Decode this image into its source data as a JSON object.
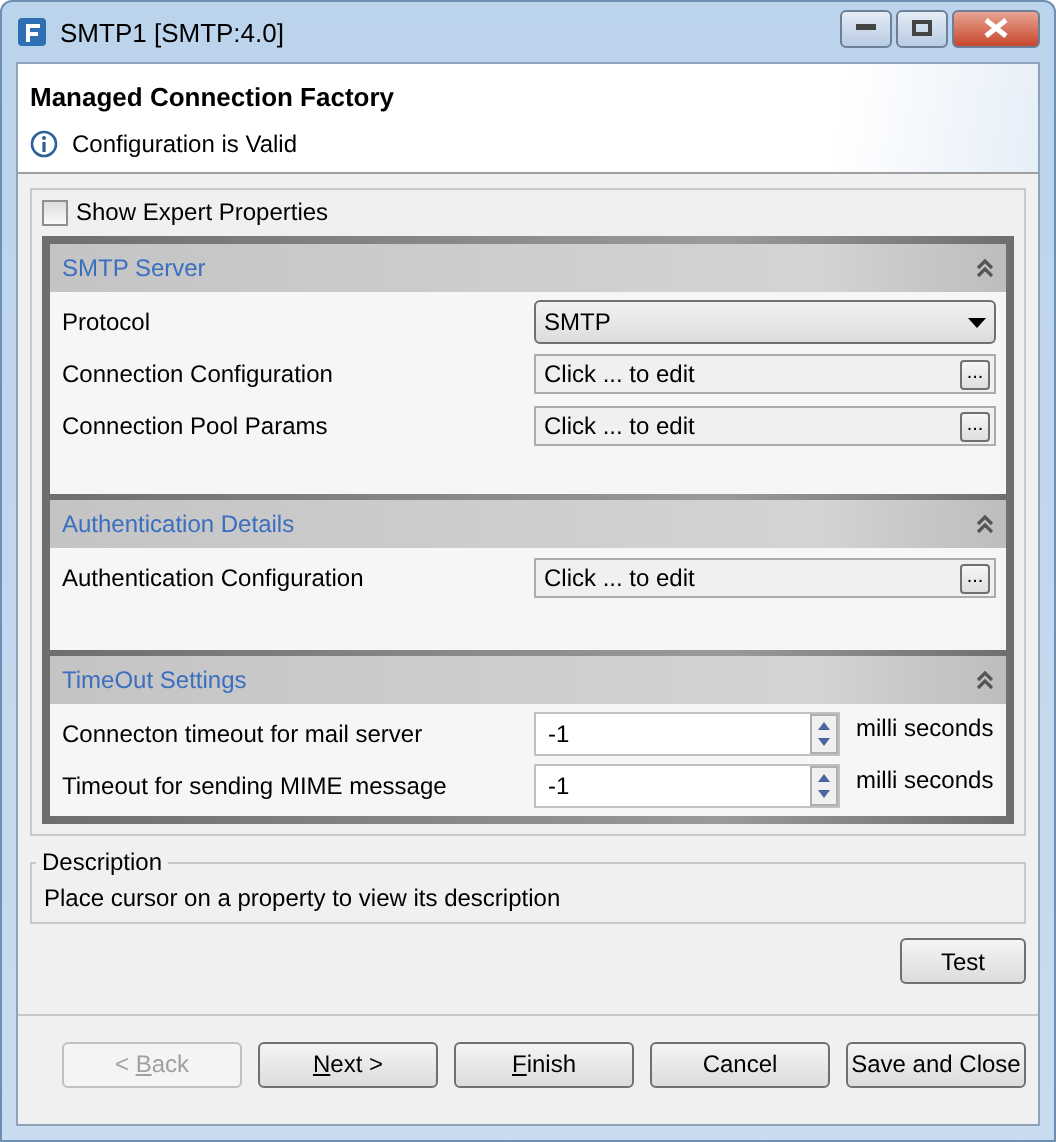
{
  "window": {
    "title": "SMTP1 [SMTP:4.0]"
  },
  "header": {
    "title": "Managed Connection Factory",
    "message": "Configuration is Valid"
  },
  "expert_checkbox": {
    "label": "Show Expert Properties",
    "checked": false
  },
  "sections": [
    {
      "title": "SMTP Server",
      "expanded": true,
      "rows": [
        {
          "kind": "dropdown",
          "label": "Protocol",
          "value": "SMTP"
        },
        {
          "kind": "edit",
          "label": "Connection Configuration",
          "value": "Click ... to edit",
          "button": "..."
        },
        {
          "kind": "edit",
          "label": "Connection Pool Params",
          "value": "Click ... to edit",
          "button": "..."
        }
      ]
    },
    {
      "title": "Authentication Details",
      "expanded": true,
      "rows": [
        {
          "kind": "edit",
          "label": "Authentication Configuration",
          "value": "Click ... to edit",
          "button": "..."
        }
      ]
    },
    {
      "title": "TimeOut Settings",
      "expanded": true,
      "rows": [
        {
          "kind": "spinner",
          "label": "Connecton timeout for mail server",
          "value": "-1",
          "unit": "milli seconds"
        },
        {
          "kind": "spinner",
          "label": "Timeout for sending MIME message",
          "value": "-1",
          "unit": "milli seconds"
        }
      ]
    }
  ],
  "description": {
    "title": "Description",
    "text": "Place cursor on a property to view its description"
  },
  "test_button": {
    "label": "Test"
  },
  "buttons": [
    {
      "before": "< ",
      "key": "B",
      "after": "ack",
      "disabled": true
    },
    {
      "key": "N",
      "after": "ext >",
      "disabled": false
    },
    {
      "key": "F",
      "after": "inish",
      "disabled": false
    },
    {
      "after": "Cancel",
      "disabled": false
    },
    {
      "after": "Save and Close",
      "disabled": false
    }
  ]
}
